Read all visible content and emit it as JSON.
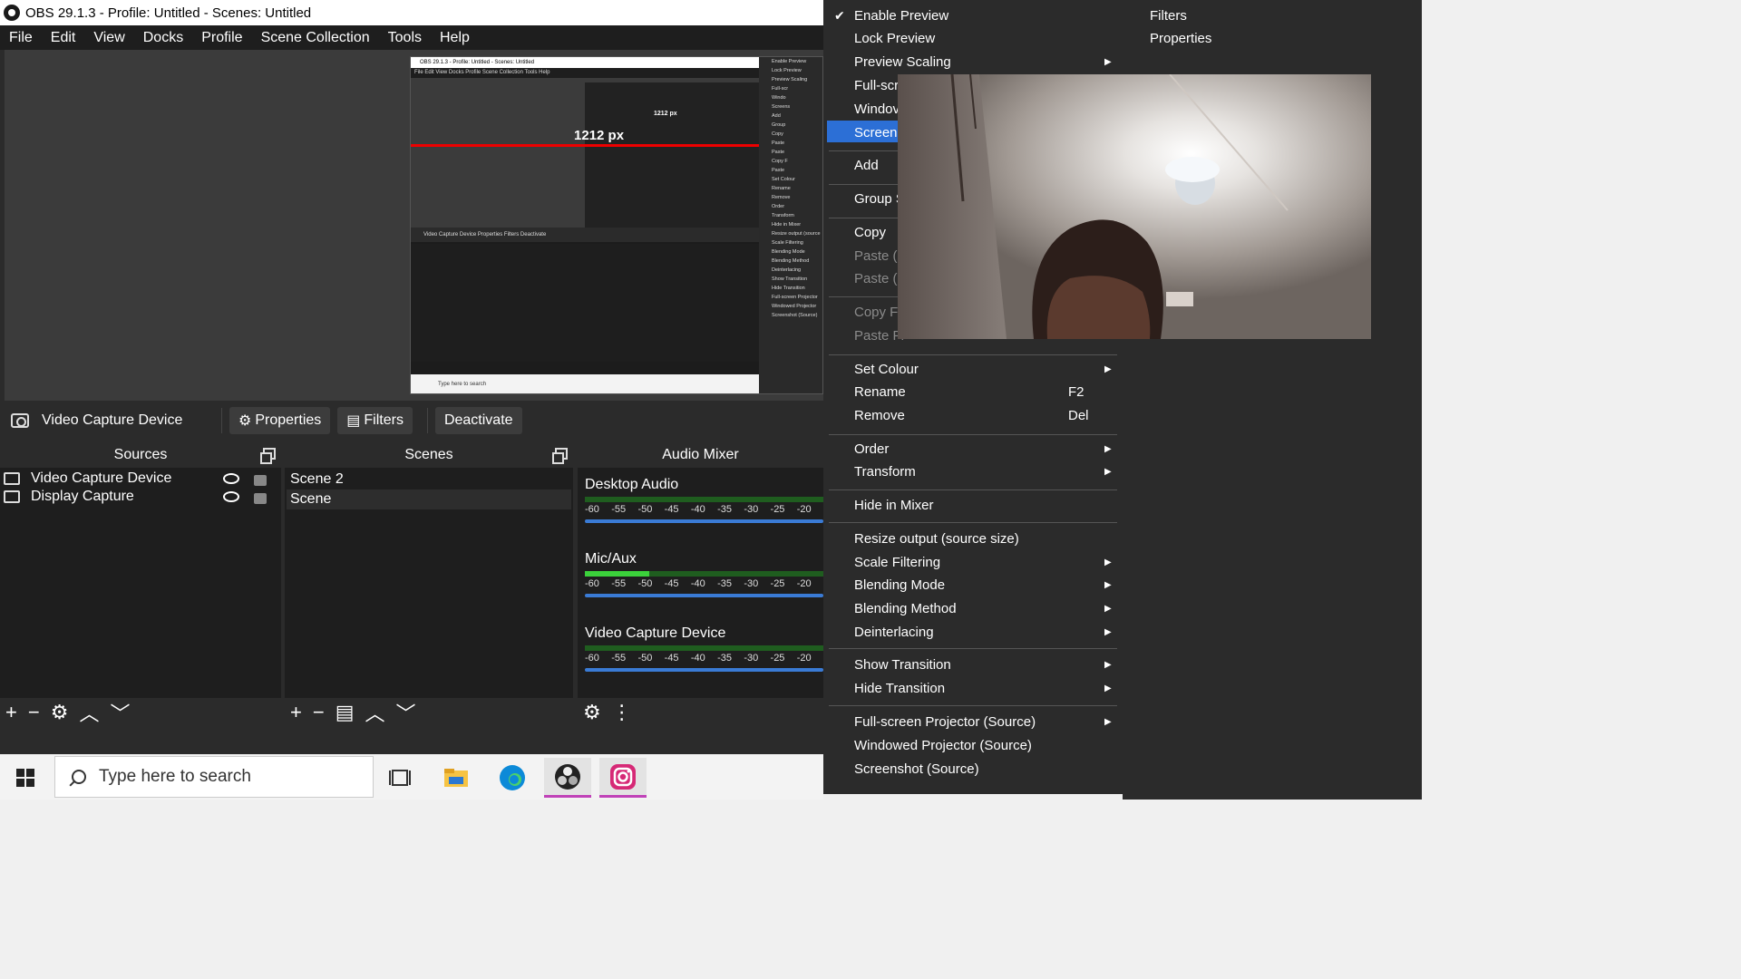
{
  "window": {
    "title": "OBS 29.1.3 - Profile: Untitled - Scenes: Untitled"
  },
  "menubar": [
    "File",
    "Edit",
    "View",
    "Docks",
    "Profile",
    "Scene Collection",
    "Tools",
    "Help"
  ],
  "nested_preview": {
    "title": "OBS 29.1.3 - Profile: Untitled - Scenes: Untitled",
    "menu": "File   Edit   View   Docks   Profile   Scene Collection   Tools   Help",
    "measure_label": "1212 px",
    "measure_label_small": "1212 px",
    "toolbar": "Video Capture Device     Properties   Filters   Deactivate",
    "taskbar_search": "Type here to search",
    "ctx_items": [
      "Enable Preview",
      "Lock Preview",
      "Preview Scaling",
      "Full-scr",
      "Windo",
      "Screens",
      "Add",
      "Group",
      "Copy",
      "Paste",
      "Paste",
      "Copy F",
      "Paste",
      "Set Colour",
      "Rename",
      "Remove",
      "Order",
      "Transform",
      "Hide in Mixer",
      "Resize output (source",
      "Scale Filtering",
      "Blending Mode",
      "Blending Method",
      "Deinterlacing",
      "Show Transition",
      "Hide Transition",
      "Full-screen Projector",
      "Windowed Projector",
      "Screenshot (Source)"
    ]
  },
  "source_toolbar": {
    "source_name": "Video Capture Device",
    "properties": "Properties",
    "filters": "Filters",
    "deactivate": "Deactivate"
  },
  "sources": {
    "header": "Sources",
    "items": [
      {
        "name": "Video Capture Device"
      },
      {
        "name": "Display Capture"
      }
    ],
    "footer": [
      "+",
      "−",
      "⚙",
      "︿",
      "﹀"
    ]
  },
  "scenes": {
    "header": "Scenes",
    "items": [
      "Scene 2",
      "Scene"
    ],
    "footer": [
      "+",
      "−",
      "▤",
      "︿",
      "﹀"
    ]
  },
  "mixer": {
    "header": "Audio Mixer",
    "channels": [
      {
        "name": "Desktop Audio",
        "level": 0.0
      },
      {
        "name": "Mic/Aux",
        "level": 0.27
      },
      {
        "name": "Video Capture Device",
        "level": 0.0
      }
    ],
    "ticks": [
      "-60",
      "-55",
      "-50",
      "-45",
      "-40",
      "-35",
      "-30",
      "-25",
      "-20"
    ],
    "footer": [
      "⚙",
      "⋮"
    ]
  },
  "taskbar": {
    "search_placeholder": "Type here to search",
    "apps": [
      "task-view",
      "file-explorer",
      "edge",
      "obs",
      "instagram"
    ]
  },
  "context_menu": {
    "items": [
      {
        "label": "Enable Preview",
        "checked": true
      },
      {
        "label": "Lock Preview"
      },
      {
        "label": "Preview Scaling",
        "submenu": true
      },
      {
        "label": "Full-scr"
      },
      {
        "label": "Windov"
      },
      {
        "label": "Screens",
        "highlighted": true
      },
      {
        "label": "Add"
      },
      {
        "label": "Group S"
      },
      {
        "label": "Copy"
      },
      {
        "label": "Paste (F",
        "disabled": true
      },
      {
        "label": "Paste (D",
        "disabled": true
      },
      {
        "label": "Copy Fi",
        "disabled": true
      },
      {
        "label": "Paste Fi",
        "disabled": true
      },
      {
        "label": "Set Colour",
        "submenu": true
      },
      {
        "label": "Rename",
        "shortcut": "F2"
      },
      {
        "label": "Remove",
        "shortcut": "Del"
      },
      {
        "label": "Order",
        "submenu": true
      },
      {
        "label": "Transform",
        "submenu": true
      },
      {
        "label": "Hide in Mixer"
      },
      {
        "label": "Resize output (source size)"
      },
      {
        "label": "Scale Filtering",
        "submenu": true
      },
      {
        "label": "Blending Mode",
        "submenu": true
      },
      {
        "label": "Blending Method",
        "submenu": true
      },
      {
        "label": "Deinterlacing",
        "submenu": true
      },
      {
        "label": "Show Transition",
        "submenu": true
      },
      {
        "label": "Hide Transition",
        "submenu": true
      },
      {
        "label": "Full-screen Projector (Source)",
        "submenu": true
      },
      {
        "label": "Windowed Projector (Source)"
      },
      {
        "label": "Screenshot (Source)"
      }
    ]
  },
  "right_items": [
    "Filters",
    "Properties"
  ],
  "colors": {
    "highlight": "#2c6fd6",
    "panel_dark": "#2b2b2b",
    "dock_dark": "#1e1e1e",
    "meter_green": "#3bd13b",
    "slider_blue": "#3a7bd5"
  }
}
